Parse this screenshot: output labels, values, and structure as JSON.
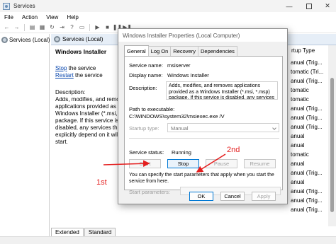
{
  "window": {
    "title": "Services"
  },
  "menu": {
    "items": [
      "File",
      "Action",
      "View",
      "Help"
    ]
  },
  "tree": {
    "root_label": "Services (Local)"
  },
  "services_header": {
    "label": "Services (Local)"
  },
  "description_pane": {
    "service_name": "Windows Installer",
    "stop_link": "Stop",
    "stop_rest": " the service",
    "restart_link": "Restart",
    "restart_rest": " the service",
    "desc_heading": "Description:",
    "desc_lines": [
      "Adds, modifies, and remov",
      "applications provided as a",
      "Windows Installer (*.msi, *",
      "package. If this service is",
      "disabled, any services that",
      "explicitly depend on it will",
      "start."
    ]
  },
  "startup_column": {
    "header": "rtup Type",
    "cells": [
      "anual (Trig...",
      "tomatic (Tri...",
      "anual (Trig...",
      "tomatic",
      "tomatic",
      "anual (Trig...",
      "anual (Trig...",
      "anual (Trig...",
      "anual",
      "anual",
      "tomatic",
      "anual",
      "anual (Trig...",
      "anual",
      "anual (Trig...",
      "anual (Trig...",
      "anual (Trig..."
    ]
  },
  "bottom_tabs": [
    "Extended",
    "Standard"
  ],
  "dialog": {
    "title": "Windows Installer Properties (Local Computer)",
    "tabs": [
      "General",
      "Log On",
      "Recovery",
      "Dependencies"
    ],
    "service_name_label": "Service name:",
    "service_name_value": "msiserver",
    "display_name_label": "Display name:",
    "display_name_value": "Windows Installer",
    "description_label": "Description:",
    "description_value": "Adds, modifies, and removes applications provided as a Windows Installer (*.msi, *.msp) package. If this service is disabled, any services that",
    "path_label": "Path to executable:",
    "path_value": "C:\\WINDOWS\\system32\\msiexec.exe /V",
    "startup_label": "Startup type:",
    "startup_value": "Manual",
    "status_label": "Service status:",
    "status_value": "Running",
    "buttons": {
      "start": "Start",
      "stop": "Stop",
      "pause": "Pause",
      "resume": "Resume"
    },
    "help_text": "You can specify the start parameters that apply when you start the service from here.",
    "params_label": "Start parameters:",
    "ok": "OK",
    "cancel": "Cancel",
    "apply": "Apply"
  },
  "annotations": {
    "first": "1st",
    "second": "2nd",
    "color": "#e41e1e"
  }
}
